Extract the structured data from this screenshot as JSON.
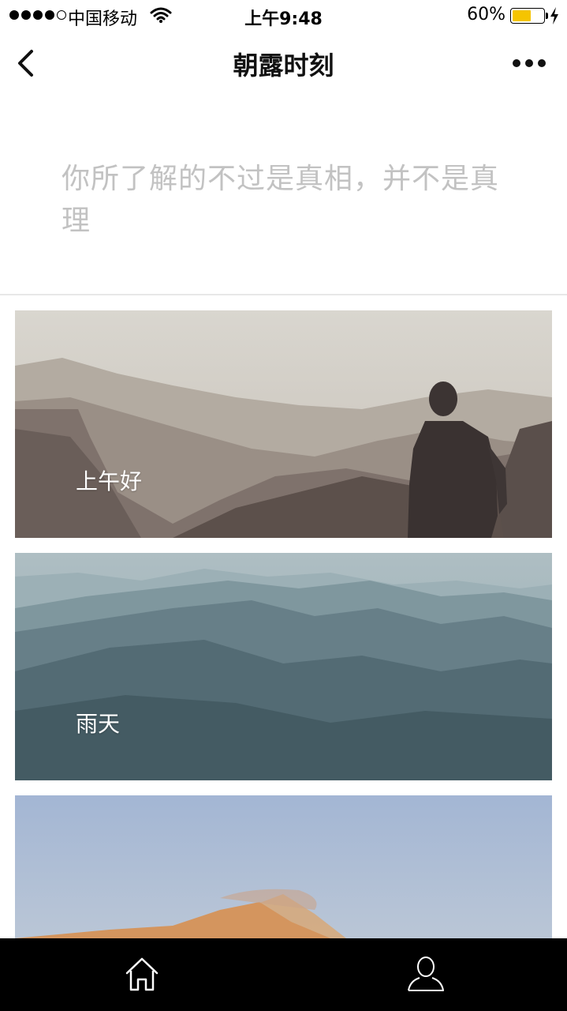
{
  "status_bar": {
    "carrier": "中国移动",
    "time": "上午9:48",
    "battery": "60%",
    "battery_level": 0.6
  },
  "nav": {
    "title": "朝露时刻",
    "back_icon": "chevron-left-icon",
    "more_icon": "more-dots-icon"
  },
  "quote": {
    "text": "你所了解的不过是真相，并不是真理"
  },
  "cards": [
    {
      "label": "上午好",
      "image": "man-on-misty-mountains"
    },
    {
      "label": "雨天",
      "image": "misty-blue-mountain-ridges"
    },
    {
      "label": "",
      "image": "desert-dune-blue-sky"
    }
  ],
  "tab_bar": {
    "items": [
      {
        "icon": "home-icon"
      },
      {
        "icon": "profile-icon"
      }
    ]
  },
  "colors": {
    "quote_text": "#c2c2c2",
    "battery_fill": "#f5c400",
    "tab_bar_bg": "#000000"
  }
}
